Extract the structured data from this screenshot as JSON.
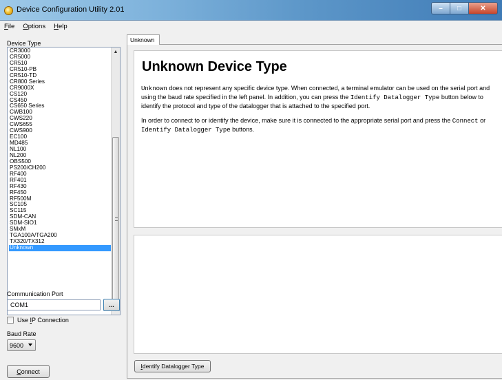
{
  "window": {
    "title": "Device Configuration Utility 2.01",
    "buttons": {
      "minimize": "–",
      "maximize": "□",
      "close": "✕"
    }
  },
  "menu": [
    {
      "label": "File",
      "accel": "F",
      "rest": "ile"
    },
    {
      "label": "Options",
      "accel": "O",
      "rest": "ptions"
    },
    {
      "label": "Help",
      "accel": "H",
      "rest": "elp"
    }
  ],
  "sidebar": {
    "device_type_label": "Device Type",
    "devices": [
      "CR3000",
      "CR5000",
      "CR510",
      "CR510-PB",
      "CR510-TD",
      "CR800 Series",
      "CR9000X",
      "CS120",
      "CS450",
      "CS650 Series",
      "CWB100",
      "CWS220",
      "CWS655",
      "CWS900",
      "EC100",
      "MD485",
      "NL100",
      "NL200",
      "OBS500",
      "PS200/CH200",
      "RF400",
      "RF401",
      "RF430",
      "RF450",
      "RF500M",
      "SC105",
      "SC115",
      "SDM-CAN",
      "SDM-SIO1",
      "SMxM",
      "TGA100A/TGA200",
      "TX320/TX312",
      "Unknown"
    ],
    "selected_device": "Unknown",
    "comm_port_label": "Communication Port",
    "comm_port_value": "COM1",
    "browse_label": "...",
    "use_ip_pre": "Use ",
    "use_ip_accel": "I",
    "use_ip_post": "P Connection",
    "baud_rate_label": "Baud Rate",
    "baud_rate_value": "9600",
    "connect_accel": "C",
    "connect_rest": "onnect"
  },
  "main": {
    "tab_label": "Unknown",
    "heading": "Unknown Device Type",
    "p1_a": "Unknown",
    "p1_b": " does not represent any specific device type. When connected, a terminal emulator can be used on the serial port and using the baud rate specified in the left panel. In addition, you can press the ",
    "p1_c": "Identify Datalogger Type",
    "p1_d": " button below to identify the protocol and type of the datalogger that is attached to the specified port.",
    "p2_a": "In order to connect to or identify the device, make sure it is connected to the appropriate serial port and press the ",
    "p2_b": "Connect",
    "p2_c": " or ",
    "p2_d": "Identify Datalogger Type",
    "p2_e": " buttons.",
    "identify_accel": "I",
    "identify_rest": "dentify Datalogger Type"
  }
}
